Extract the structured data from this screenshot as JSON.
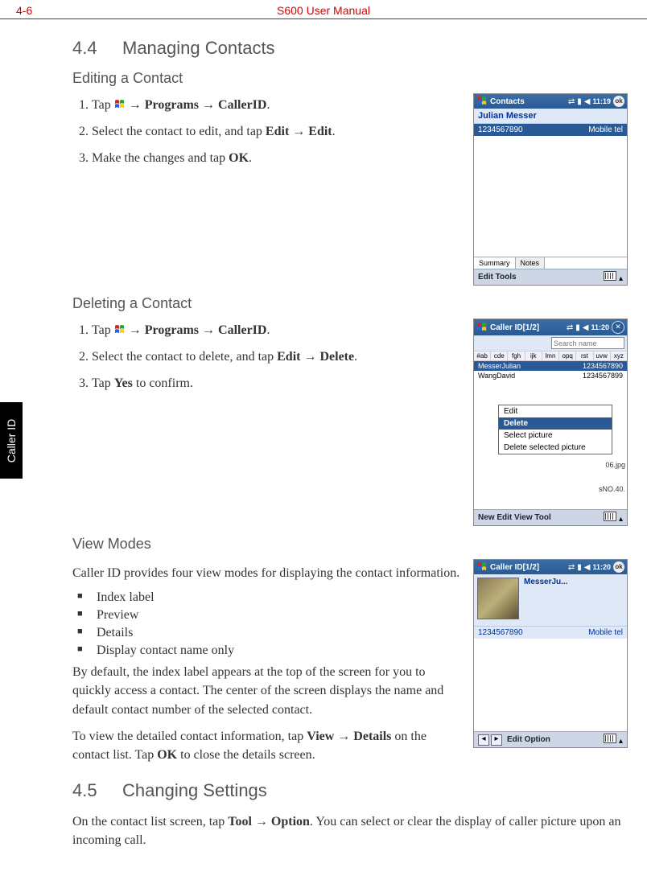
{
  "header": {
    "left": "4-6",
    "center": "S600 User Manual"
  },
  "sideTab": "Caller ID",
  "sec44": {
    "num": "4.4",
    "title": "Managing Contacts",
    "edit": {
      "heading": "Editing a Contact",
      "step1_a": "Tap ",
      "step1_b": " → ",
      "step1_programs": "Programs",
      "step1_c": " → ",
      "step1_callerid": "CallerID",
      "step1_d": ".",
      "step2_a": "Select the contact to edit, and tap ",
      "step2_edit1": "Edit",
      "step2_b": " → ",
      "step2_edit2": "Edit",
      "step2_c": ".",
      "step3_a": "Make the changes and tap ",
      "step3_ok": "OK",
      "step3_b": "."
    },
    "delete": {
      "heading": "Deleting a Contact",
      "step1_a": "Tap ",
      "step1_b": " → ",
      "step1_programs": "Programs",
      "step1_c": " → ",
      "step1_callerid": "CallerID",
      "step1_d": ".",
      "step2_a": "Select the contact to delete, and tap ",
      "step2_edit": "Edit",
      "step2_b": " → ",
      "step2_delete": "Delete",
      "step2_c": ".",
      "step3_a": "Tap ",
      "step3_yes": "Yes",
      "step3_b": " to confirm."
    },
    "view": {
      "heading": "View Modes",
      "intro": "Caller ID provides four view modes for displaying the contact information.",
      "items": [
        "Index label",
        "Preview",
        "Details",
        "Display contact name only"
      ],
      "p2_a": "By default, the index label appears at the top of the screen for you to quickly access a contact. The center of the screen displays the name and default contact number of the selected contact.",
      "p3_a": "To view the detailed contact information, tap ",
      "p3_view": "View",
      "p3_b": " → ",
      "p3_details": "Details",
      "p3_c": " on the contact list. Tap ",
      "p3_ok": "OK",
      "p3_d": " to close the details screen."
    }
  },
  "sec45": {
    "num": "4.5",
    "title": "Changing Settings",
    "p_a": "On the contact list screen, tap ",
    "p_tool": "Tool",
    "p_b": " → ",
    "p_option": "Option",
    "p_c": ". You can select or clear the display of caller picture upon an incoming call."
  },
  "shot1": {
    "title": "Contacts",
    "time": "11:19",
    "name": "Julian Messer",
    "phone": "1234567890",
    "phoneType": "Mobile tel",
    "tabs": [
      "Summary",
      "Notes"
    ],
    "menus": "Edit  Tools"
  },
  "shot2": {
    "title": "Caller ID[1/2]",
    "time": "11:20",
    "searchPlaceholder": "Search name",
    "index": [
      "#ab",
      "cde",
      "fgh",
      "ijk",
      "lmn",
      "opq",
      "rst",
      "uvw",
      "xyz"
    ],
    "rows": [
      {
        "name": "MesserJulian",
        "num": "1234567890"
      },
      {
        "name": "WangDavid",
        "num": "1234567899"
      }
    ],
    "sideLabels": [
      "06.jpg",
      "sNO.40."
    ],
    "popup": [
      "Edit",
      "Delete",
      "Select picture",
      "Delete selected picture"
    ],
    "menus": "New Edit View Tool"
  },
  "shot3": {
    "title": "Caller ID[1/2]",
    "time": "11:20",
    "name": "MesserJu...",
    "phone": "1234567890",
    "phoneType": "Mobile tel",
    "menus": "Edit  Option"
  }
}
